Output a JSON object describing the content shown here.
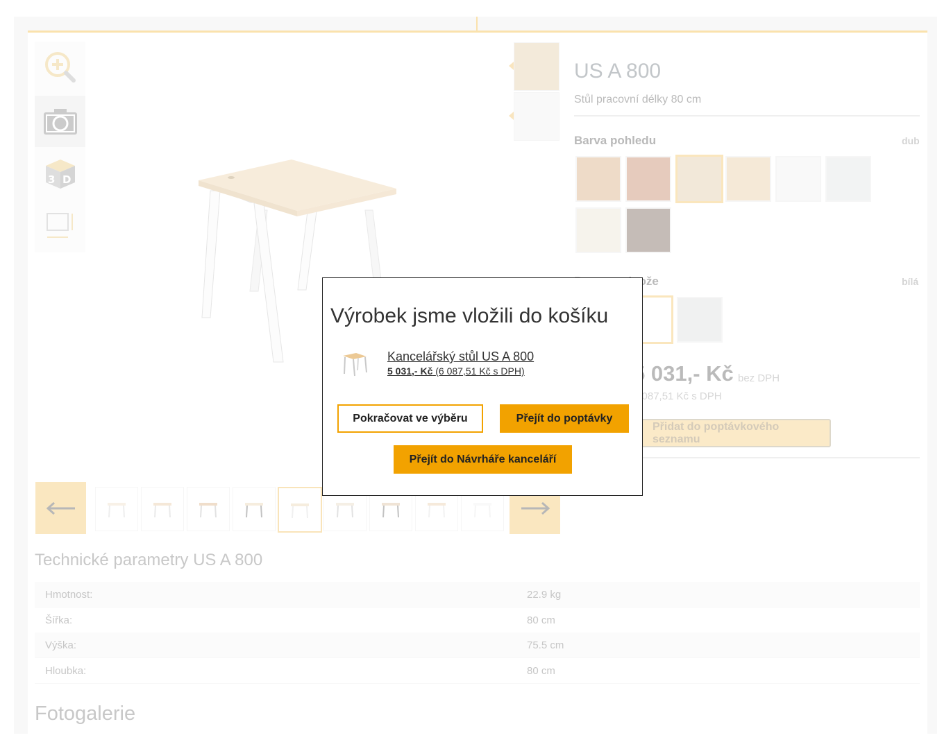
{
  "product": {
    "title": "US A 800",
    "subtitle": "Stůl pracovní délky 80 cm",
    "view_color": {
      "label": "Barva pohledu",
      "value": "dub"
    },
    "frame_color": {
      "label": "Barva podnože",
      "value": "bílá"
    },
    "price": "5 031,- Kč",
    "price_note": "bez DPH",
    "price_vat": "6 087,51 Kč s DPH",
    "add_button": "Přidat do poptávkového seznamu",
    "swatch_colors": [
      "#e3c3a3",
      "#d5a991",
      "#ead9c0",
      "#efdbbd",
      "#f5f5f5",
      "#e9ebeb",
      "#f0ebe0",
      "#9f8f87"
    ],
    "frame_swatch_colors": [
      "#ffffff",
      "#e6e8e8"
    ]
  },
  "tools": [
    "zoom-in-icon",
    "camera-icon",
    "3d-icon",
    "dimensions-icon"
  ],
  "tech": {
    "title": "Technické parametry US A 800",
    "rows": [
      {
        "k": "Hmotnost:",
        "v": "22.9 kg"
      },
      {
        "k": "Šířka:",
        "v": "80 cm"
      },
      {
        "k": "Výška:",
        "v": "75.5 cm"
      },
      {
        "k": "Hloubka:",
        "v": "80 cm"
      }
    ]
  },
  "gallery_title": "Fotogalerie",
  "modal": {
    "title": "Výrobek jsme vložili do košíku",
    "product_link": "Kancelářský stůl US A 800",
    "price_bold": "5 031,- Kč",
    "price_vat": "(6 087,51 Kč s DPH)",
    "continue_btn": "Pokračovat ve výběru",
    "inquiry_btn": "Přejít do poptávky",
    "designer_btn": "Přejít do Návrháře kanceláří"
  },
  "colors": {
    "accent": "#f2a200",
    "accent_light": "#f7cf77"
  }
}
